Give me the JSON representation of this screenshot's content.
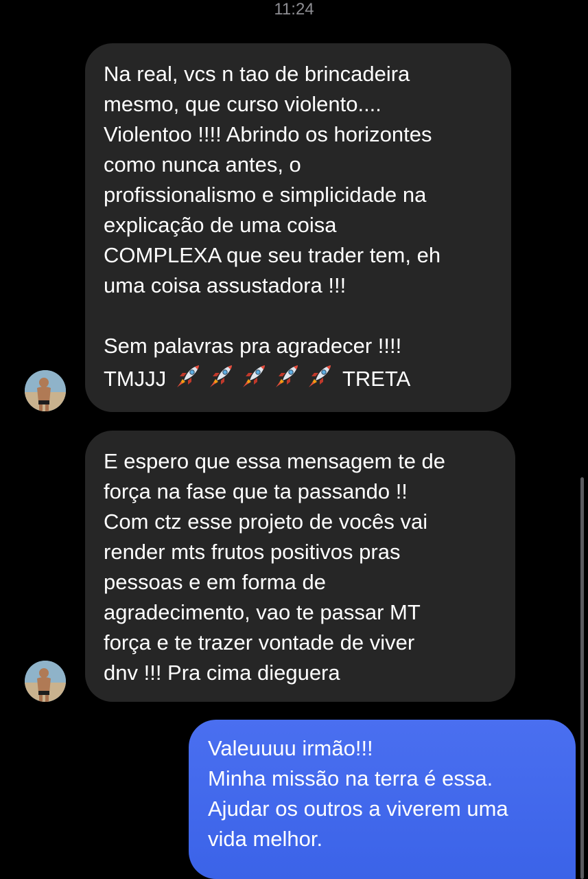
{
  "status": {
    "time": "11:24"
  },
  "conversation": {
    "messages": [
      {
        "direction": "incoming",
        "text": "Na real, vcs n tao de brincadeira\nmesmo, que curso violento....\nViolentoo !!!! Abrindo os horizontes\ncomo nunca antes, o\nprofissionalismo e simplicidade na\nexplicação de uma coisa\nCOMPLEXA que seu trader tem, eh\numa coisa assustadora !!!\n\nSem palavras pra agradecer !!!!",
        "tail_start": "TMJJJ",
        "tail_emoji_count": 5,
        "tail_end": "TRETA",
        "emoji_icon": "rocket-icon"
      },
      {
        "direction": "incoming",
        "text": "E espero que essa mensagem te de\nforça na fase que ta passando !!\nCom ctz esse projeto de vocês vai\nrender mts frutos positivos pras\npessoas e em forma de\nagradecimento, vao te passar MT\nforça e te trazer vontade de viver\ndnv !!! Pra cima dieguera"
      },
      {
        "direction": "outgoing",
        "text": "Valeuuuu irmão!!!\nMinha missão na terra é essa.\nAjudar os outros a viverem uma\nvida melhor."
      }
    ]
  },
  "colors": {
    "background": "#000000",
    "incoming_bubble": "#262626",
    "outgoing_bubble": "#3f66eb",
    "timestamp": "#8e8e93"
  }
}
